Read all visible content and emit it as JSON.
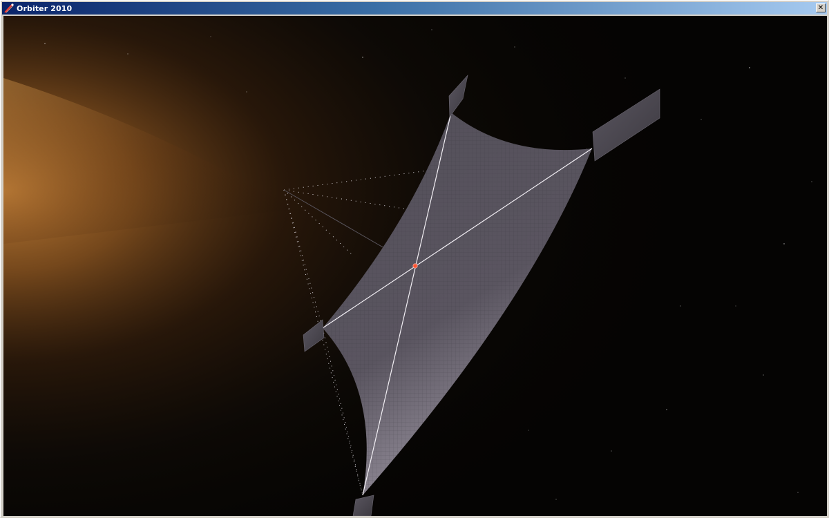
{
  "window": {
    "title": "Orbiter 2010",
    "close_glyph": "✕",
    "app_icon": "orbiter-rocket-icon",
    "close_icon": "close-icon"
  },
  "scene": {
    "description_colors": {
      "space": "#000000",
      "glow": "#c8843a",
      "sail": "#6e6872",
      "sail_light": "#c4bec8",
      "rigging": "#ffffff",
      "center_hub": "#ff5533"
    }
  }
}
